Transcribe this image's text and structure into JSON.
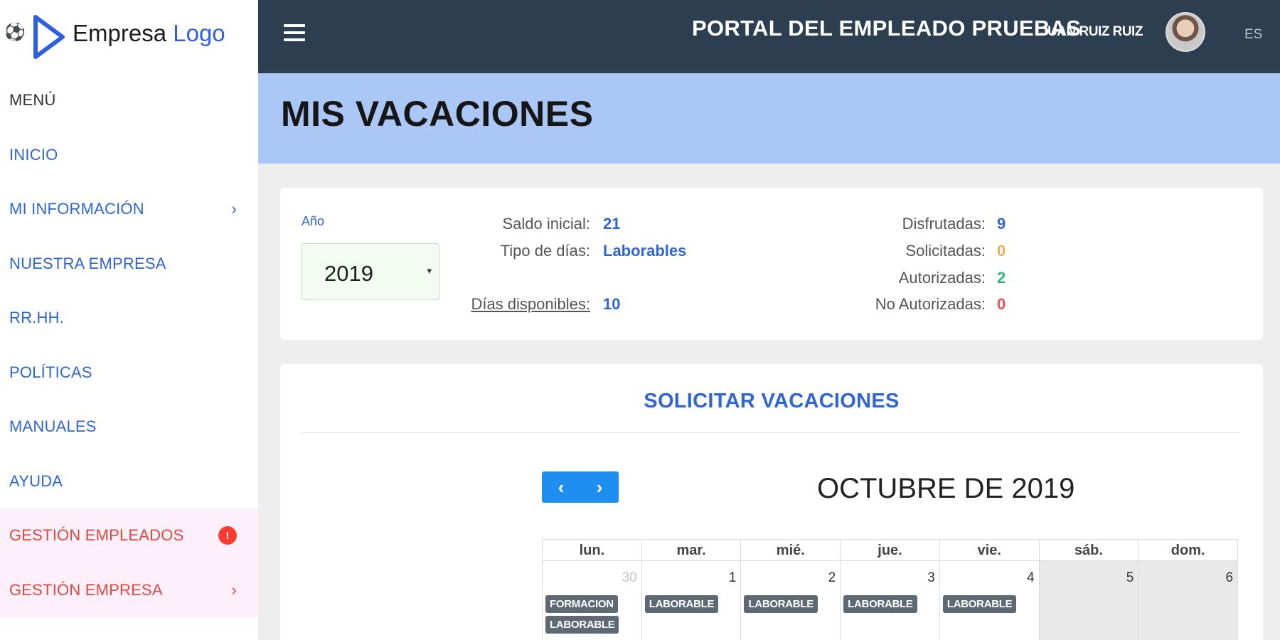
{
  "brand": {
    "icon": "soccer-ball-icon",
    "name_part1": "Empresa",
    "name_part2": "Logo",
    "accent": "#2f5fe0"
  },
  "sidebar": {
    "heading": "MENÚ",
    "items": [
      {
        "label": "INICIO",
        "chevron": false
      },
      {
        "label": "MI INFORMACIÓN",
        "chevron": true
      },
      {
        "label": "NUESTRA EMPRESA",
        "chevron": false
      },
      {
        "label": "RR.HH.",
        "chevron": false
      },
      {
        "label": "POLÍTICAS",
        "chevron": false
      },
      {
        "label": "MANUALES",
        "chevron": false
      },
      {
        "label": "AYUDA",
        "chevron": false
      },
      {
        "label": "GESTIÓN EMPLEADOS",
        "badge": "!",
        "highlight": true
      },
      {
        "label": "GESTIÓN EMPRESA",
        "chevron": true,
        "highlight": true
      }
    ],
    "chevron_glyph": "›"
  },
  "topbar": {
    "portal_title": "PORTAL DEL EMPLEADO PRUEBAS",
    "user_name": "JUAN RUIZ RUIZ",
    "language": "ES",
    "bg_color": "#2c3e50"
  },
  "page": {
    "title": "MIS VACACIONES",
    "header_color": "#aac7f6"
  },
  "summary": {
    "year_label": "Año",
    "year_value": "2019",
    "caret": "▾",
    "saldo_label": "Saldo inicial:",
    "saldo_value": "21",
    "tipo_label": "Tipo de días:",
    "tipo_value": "Laborables",
    "disponibles_label": "Días disponibles:",
    "disponibles_value": "10",
    "disfrutadas_label": "Disfrutadas:",
    "disfrutadas_value": "9",
    "solicitadas_label": "Solicitadas:",
    "solicitadas_value": "0",
    "autorizadas_label": "Autorizadas:",
    "autorizadas_value": "2",
    "no_autorizadas_label": "No Autorizadas:",
    "no_autorizadas_value": "0",
    "colors": {
      "blue": "#2e66d4",
      "orange": "#f0ad4e",
      "green": "#2fb67c",
      "red": "#f0524a"
    }
  },
  "calendar": {
    "section_title": "SOLICITAR VACACIONES",
    "prev_glyph": "‹",
    "next_glyph": "›",
    "month_title": "OCTUBRE DE 2019",
    "weekdays": [
      "lun.",
      "mar.",
      "mié.",
      "jue.",
      "vie.",
      "sáb.",
      "dom."
    ],
    "days": [
      {
        "num": "30",
        "other": true,
        "weekend": false,
        "events": [
          "FORMACION",
          "LABORABLE"
        ]
      },
      {
        "num": "1",
        "other": false,
        "weekend": false,
        "events": [
          "LABORABLE"
        ]
      },
      {
        "num": "2",
        "other": false,
        "weekend": false,
        "events": [
          "LABORABLE"
        ]
      },
      {
        "num": "3",
        "other": false,
        "weekend": false,
        "events": [
          "LABORABLE"
        ]
      },
      {
        "num": "4",
        "other": false,
        "weekend": false,
        "events": [
          "LABORABLE"
        ]
      },
      {
        "num": "5",
        "other": false,
        "weekend": true,
        "events": []
      },
      {
        "num": "6",
        "other": false,
        "weekend": true,
        "events": []
      }
    ]
  }
}
